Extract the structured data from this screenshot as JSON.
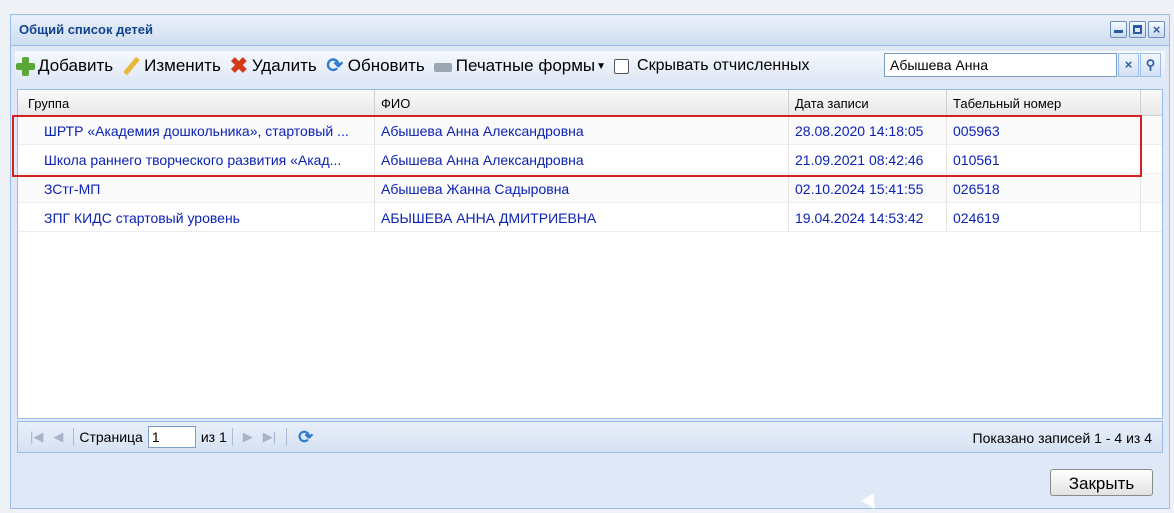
{
  "window": {
    "title": "Общий список детей"
  },
  "toolbar": {
    "add": "Добавить",
    "edit": "Изменить",
    "delete": "Удалить",
    "refresh": "Обновить",
    "print_forms": "Печатные формы",
    "hide_expelled": "Скрывать отчисленных",
    "search_value": "Абышева Анна"
  },
  "grid": {
    "columns": [
      "Группа",
      "ФИО",
      "Дата записи",
      "Табельный номер"
    ],
    "rows": [
      {
        "group": "ШРТР «Академия дошкольника», стартовый ...",
        "name": "Абышева Анна Александровна",
        "date": "28.08.2020 14:18:05",
        "number": "005963"
      },
      {
        "group": "Школа раннего творческого развития «Акад...",
        "name": "Абышева Анна Александровна",
        "date": "21.09.2021 08:42:46",
        "number": "010561"
      },
      {
        "group": "ЗСтг-МП",
        "name": "Абышева Жанна Садыровна",
        "date": "02.10.2024 15:41:55",
        "number": "026518"
      },
      {
        "group": "ЗПГ КИДС стартовый уровень",
        "name": "АБЫШЕВА АННА ДМИТРИЕВНА",
        "date": "19.04.2024 14:53:42",
        "number": "024619"
      }
    ]
  },
  "pager": {
    "page_label": "Страница",
    "page_value": "1",
    "of_label": "из 1",
    "info": "Показано записей 1 - 4 из 4"
  },
  "footer": {
    "close": "Закрыть"
  },
  "colors": {
    "accent": "#15428b",
    "link": "#0b22b4",
    "highlight": "#d42020"
  }
}
